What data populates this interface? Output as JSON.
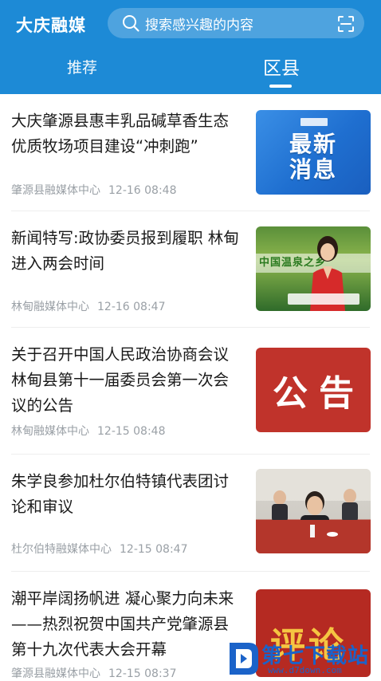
{
  "header": {
    "brand": "大庆融媒",
    "search_placeholder": "搜索感兴趣的内容",
    "accent": "#1d8ad6"
  },
  "tabs": [
    {
      "label": "推荐",
      "active": false
    },
    {
      "label": "区县",
      "active": true
    }
  ],
  "articles": [
    {
      "title": "大庆肇源县惠丰乳品碱草香生态优质牧场项目建设“冲刺跑”",
      "source": "肇源县融媒体中心",
      "time": "12-16 08:48",
      "thumb": "latest-news",
      "thumb_text": "最新\n消息"
    },
    {
      "title": "新闻特写:政协委员报到履职 林甸进入两会时间",
      "source": "林甸融媒体中心",
      "time": "12-16 08:47",
      "thumb": "tv-anchor",
      "thumb_text": "中国温泉之乡"
    },
    {
      "title": "关于召开中国人民政治协商会议林甸县第十一届委员会第一次会议的公告",
      "source": "林甸融媒体中心",
      "time": "12-15 08:48",
      "thumb": "notice",
      "thumb_text": "公告"
    },
    {
      "title": "朱学良参加杜尔伯特镇代表团讨论和审议",
      "source": "杜尔伯特融媒体中心",
      "time": "12-15 08:47",
      "thumb": "meeting-photo",
      "thumb_text": ""
    },
    {
      "title": "潮平岸阔扬帆进 凝心聚力向未来 ——热烈祝贺中国共产党肇源县第十九次代表大会开幕",
      "source": "肇源县融媒体中心",
      "time": "12-15 08:37",
      "thumb": "commentary",
      "thumb_text": "评论"
    }
  ],
  "watermark": {
    "text": "第七下载站",
    "url": "www.d7down.com"
  }
}
